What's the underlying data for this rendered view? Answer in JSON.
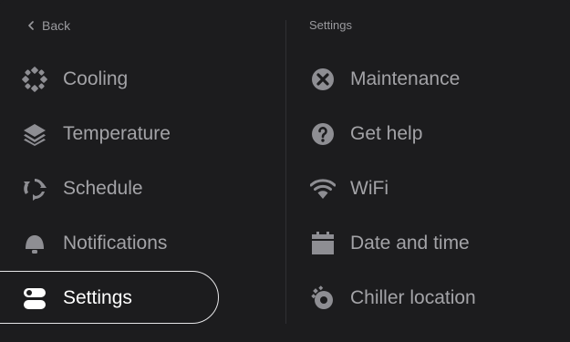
{
  "nav": {
    "back_label": "Back"
  },
  "left_menu": {
    "items": [
      {
        "label": "Cooling",
        "icon": "snowflake-icon"
      },
      {
        "label": "Temperature",
        "icon": "layers-icon"
      },
      {
        "label": "Schedule",
        "icon": "cycle-arrows-icon"
      },
      {
        "label": "Notifications",
        "icon": "bell-icon"
      },
      {
        "label": "Settings",
        "icon": "toggles-icon",
        "selected": true
      }
    ]
  },
  "right_menu": {
    "heading": "Settings",
    "items": [
      {
        "label": "Maintenance",
        "icon": "wrench-cross-icon"
      },
      {
        "label": "Get help",
        "icon": "help-circle-icon"
      },
      {
        "label": "WiFi",
        "icon": "wifi-icon"
      },
      {
        "label": "Date and time",
        "icon": "calendar-icon"
      },
      {
        "label": "Chiller location",
        "icon": "location-icon"
      }
    ]
  },
  "colors": {
    "background": "#1c1c1e",
    "text_muted": "#a3a3a7",
    "text_selected": "#ffffff",
    "icon": "#8e8e93"
  }
}
